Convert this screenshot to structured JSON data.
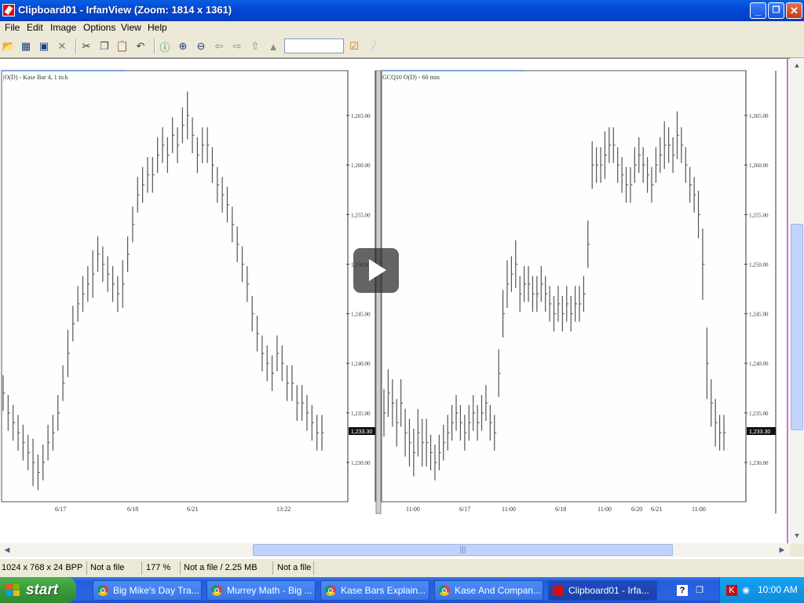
{
  "window": {
    "title": "Clipboard01 - IrfanView (Zoom: 1814 x 1361)",
    "minimize": "_",
    "maximize": "❐",
    "close": "✕"
  },
  "menu": [
    "File",
    "Edit",
    "Image",
    "Options",
    "View",
    "Help"
  ],
  "toolbar": {
    "icons": [
      "open-icon",
      "slideshow-icon",
      "save-icon",
      "delete-icon",
      "cut-icon",
      "copy-icon",
      "paste-icon",
      "undo-icon",
      "info-icon",
      "zoom-in-icon",
      "zoom-out-icon",
      "previous-icon",
      "next-icon",
      "first-icon",
      "last-icon"
    ],
    "zoom_value": ""
  },
  "charts": [
    {
      "title": "|O(D) - Kase Bar 4, 1 tick",
      "x_ticks": [
        "6/17",
        "6/18",
        "6/21",
        "13:22"
      ],
      "last_price": "1,233.30"
    },
    {
      "title": "GCQ10 O(D) - 60 min",
      "x_ticks": [
        "11:00",
        "6/17",
        "11:00",
        "6/18",
        "11:00",
        "6/20",
        "6/21",
        "11:00"
      ],
      "last_price": "1,233.30"
    }
  ],
  "chart_data": [
    {
      "type": "ohlc",
      "title": "|O(D) - Kase Bar 4, 1 tick",
      "x_ticks": [
        "6/17",
        "6/18",
        "6/21",
        "13:22"
      ],
      "y_ticks": [
        "1,265.00",
        "1,260.00",
        "1,255.00",
        "1,250.00",
        "1,245.00",
        "1,240.00",
        "1,235.00",
        "1,230.00"
      ],
      "ylim": [
        1227,
        1268
      ],
      "last_price": 1233.3,
      "close": [
        1237,
        1235,
        1234,
        1233,
        1232,
        1231,
        1230,
        1229,
        1230,
        1232,
        1233,
        1235,
        1238,
        1241,
        1244,
        1246,
        1247,
        1248,
        1249,
        1251,
        1250,
        1249,
        1248,
        1247,
        1248,
        1251,
        1254,
        1257,
        1258,
        1259,
        1259,
        1261,
        1262,
        1261,
        1263,
        1262,
        1264,
        1265,
        1263,
        1261,
        1262,
        1262,
        1260,
        1258,
        1257,
        1256,
        1254,
        1252,
        1250,
        1248,
        1245,
        1243,
        1241,
        1240,
        1239,
        1241,
        1240,
        1238,
        1238,
        1236,
        1236,
        1235,
        1234,
        1233,
        1233
      ],
      "range": [
        3,
        3,
        3,
        3,
        3,
        3,
        4,
        3,
        3,
        3,
        3,
        3,
        3,
        4,
        3,
        3,
        3,
        3,
        4,
        3,
        3,
        3,
        3,
        3,
        4,
        3,
        3,
        3,
        3,
        3,
        3,
        3,
        3,
        3,
        3,
        3,
        3,
        4,
        3,
        3,
        3,
        3,
        3,
        3,
        3,
        3,
        3,
        3,
        3,
        3,
        3,
        3,
        3,
        3,
        3,
        3,
        3,
        3,
        3,
        3,
        3,
        3,
        3,
        3,
        3
      ]
    },
    {
      "type": "ohlc",
      "title": "GCQ10 O(D) - 60 min",
      "x_ticks": [
        "11:00",
        "6/17",
        "11:00",
        "6/18",
        "11:00",
        "6/20",
        "6/21",
        "11:00"
      ],
      "y_ticks": [
        "1,265.00",
        "1,260.00",
        "1,255.00",
        "1,250.00",
        "1,245.00",
        "1,240.00",
        "1,235.00",
        "1,230.00"
      ],
      "ylim": [
        1227,
        1268
      ],
      "last_price": 1233.3,
      "close": [
        1235,
        1237,
        1236,
        1234,
        1236,
        1233,
        1232,
        1231,
        1233,
        1232,
        1232,
        1231,
        1230,
        1231,
        1232,
        1233,
        1234,
        1235,
        1234,
        1233,
        1234,
        1235,
        1234,
        1235,
        1236,
        1234,
        1233,
        1239,
        1245,
        1248,
        1249,
        1250,
        1247,
        1248,
        1248,
        1247,
        1247,
        1248,
        1247,
        1246,
        1245,
        1246,
        1245,
        1246,
        1245,
        1246,
        1246,
        1247,
        1252,
        1260,
        1260,
        1260,
        1261,
        1262,
        1262,
        1260,
        1259,
        1258,
        1258,
        1260,
        1261,
        1260,
        1259,
        1258,
        1260,
        1261,
        1262,
        1262,
        1261,
        1263,
        1262,
        1260,
        1258,
        1257,
        1255,
        1250,
        1240,
        1236,
        1234,
        1233,
        1233
      ],
      "range": [
        4,
        4,
        4,
        4,
        4,
        4,
        4,
        4,
        4,
        4,
        4,
        3,
        3,
        3,
        3,
        3,
        3,
        3,
        3,
        3,
        3,
        3,
        3,
        3,
        3,
        3,
        3,
        4,
        4,
        4,
        3,
        4,
        3,
        3,
        3,
        3,
        3,
        3,
        3,
        3,
        3,
        3,
        3,
        3,
        3,
        3,
        3,
        3,
        4,
        4,
        3,
        3,
        4,
        3,
        3,
        3,
        3,
        3,
        3,
        3,
        3,
        3,
        3,
        3,
        3,
        3,
        4,
        3,
        3,
        4,
        3,
        3,
        3,
        3,
        4,
        6,
        6,
        4,
        4,
        3,
        3
      ]
    }
  ],
  "scrollbars": {
    "h_grip": "|||"
  },
  "status": {
    "dims": "1024 x 768 x 24 BPP",
    "file1": "Not a file",
    "zoom": "177 %",
    "file2": "Not a file / 2.25 MB",
    "file3": "Not a file"
  },
  "taskbar": {
    "start": "start",
    "tasks": [
      "Big Mike's Day Tra...",
      "Murrey Math - Big ...",
      "Kase Bars Explain...",
      "Kase And Compan...",
      "Clipboard01 - Irfa..."
    ],
    "clock": "10:00 AM"
  }
}
